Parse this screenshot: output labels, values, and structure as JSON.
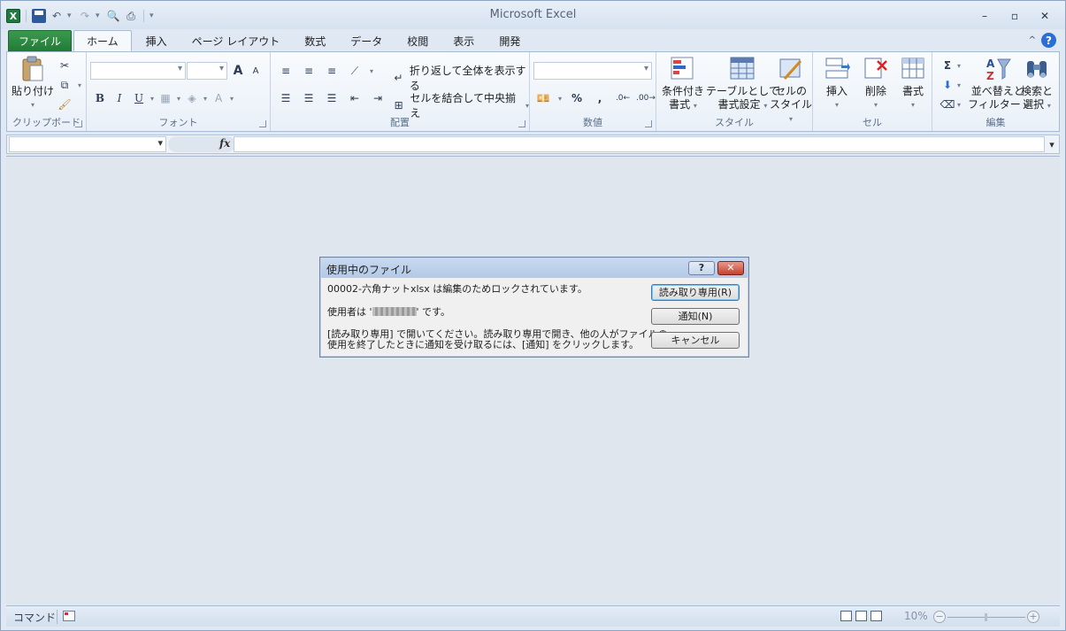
{
  "window": {
    "title": "Microsoft Excel",
    "controls": {
      "minimize": "–",
      "restore": "▫",
      "close": "✕"
    }
  },
  "qat": {
    "icons": [
      "excel-logo",
      "save-icon",
      "undo-icon",
      "redo-icon",
      "print-preview-icon",
      "print-icon",
      "customize-icon"
    ],
    "logo_letter": "X"
  },
  "tabs": [
    "ファイル",
    "ホーム",
    "挿入",
    "ページ レイアウト",
    "数式",
    "データ",
    "校閲",
    "表示",
    "開発"
  ],
  "ribbon": {
    "clipboard": {
      "label": "クリップボード",
      "paste": "貼り付け"
    },
    "font": {
      "label": "フォント",
      "bold": "B",
      "italic": "I",
      "underline": "U",
      "grow": "A",
      "shrink": "A"
    },
    "alignment": {
      "label": "配置",
      "wrap": "折り返して全体を表示する",
      "merge": "セルを結合して中央揃え"
    },
    "number": {
      "label": "数値",
      "percent": "%",
      "comma": ","
    },
    "styles": {
      "label": "スタイル",
      "conditional_1": "条件付き",
      "conditional_2": "書式",
      "table_1": "テーブルとして",
      "table_2": "書式設定",
      "cell_1": "セルの",
      "cell_2": "スタイル"
    },
    "cells": {
      "label": "セル",
      "insert": "挿入",
      "delete": "削除",
      "format": "書式"
    },
    "editing": {
      "label": "編集",
      "sigma": "Σ",
      "sort_1": "並べ替えと",
      "sort_2": "フィルター",
      "find_1": "検索と",
      "find_2": "選択"
    }
  },
  "formula_bar": {
    "fx": "fx"
  },
  "status_bar": {
    "mode": "コマンド",
    "zoom": "10%"
  },
  "dialog": {
    "title": "使用中のファイル",
    "help": "?",
    "close": "✕",
    "line1": "00002-六角ナットxlsx は編集のためロックされています。",
    "line2_prefix": "使用者は '",
    "line2_suffix": "' です。",
    "line3a": "[読み取り専用] で開いてください。読み取り専用で開き、他の人がファイルの",
    "line3b": "使用を終了したときに通知を受け取るには、[通知] をクリックします。",
    "buttons": {
      "read_only": "読み取り専用(R)",
      "notify": "通知(N)",
      "cancel": "キャンセル"
    }
  }
}
